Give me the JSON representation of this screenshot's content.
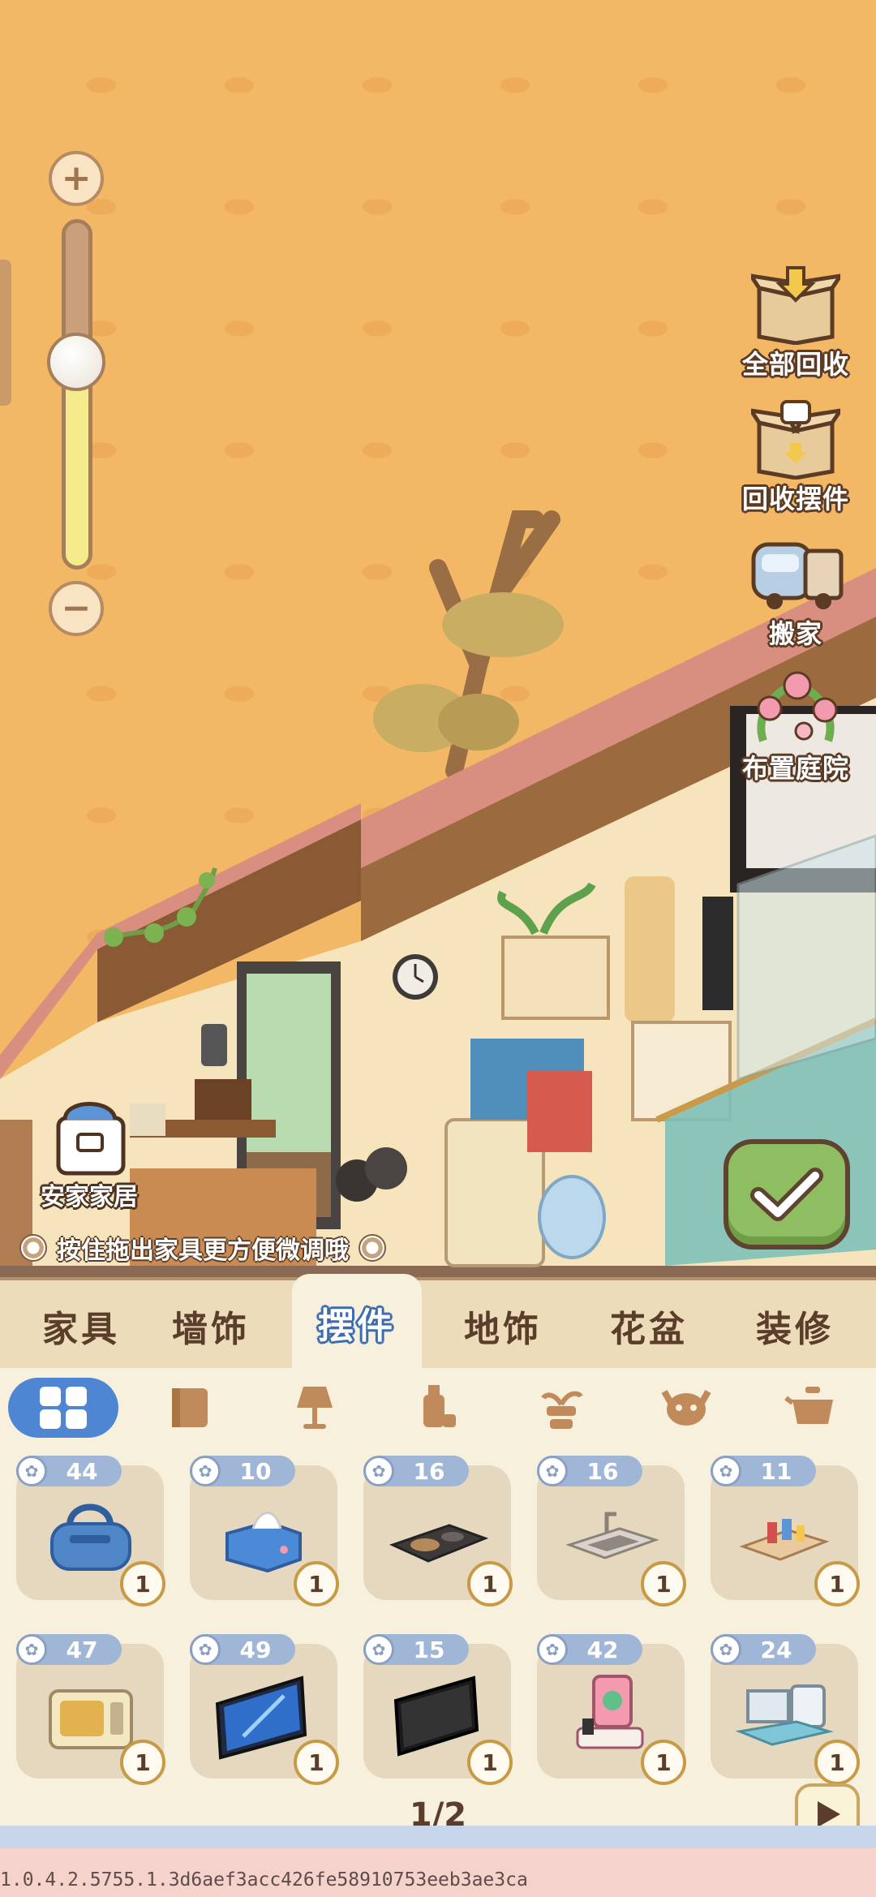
{
  "actions": [
    {
      "label": "全部回收",
      "icon": "box-collect-all-icon"
    },
    {
      "label": "回收摆件",
      "icon": "box-collect-ornament-icon"
    },
    {
      "label": "搬家",
      "icon": "moving-truck-icon"
    },
    {
      "label": "布置庭院",
      "icon": "garden-flowers-icon"
    }
  ],
  "anjia_label": "安家家居",
  "hint_text": "按住拖出家具更方便微调哦",
  "tabs": [
    {
      "label": "家具"
    },
    {
      "label": "墙饰"
    },
    {
      "label": "摆件",
      "active": true
    },
    {
      "label": "地饰"
    },
    {
      "label": "花盆"
    },
    {
      "label": "装修"
    }
  ],
  "subcategories": [
    "all-grid-icon",
    "rug-icon",
    "lamp-icon",
    "bottle-icon",
    "plant-stand-icon",
    "cow-head-icon",
    "teapot-icon"
  ],
  "items": [
    {
      "score": "44",
      "count": "1",
      "icon": "duffel-bag-icon"
    },
    {
      "score": "10",
      "count": "1",
      "icon": "tissue-box-icon"
    },
    {
      "score": "16",
      "count": "1",
      "icon": "induction-cooker-icon"
    },
    {
      "score": "16",
      "count": "1",
      "icon": "kitchen-sink-icon"
    },
    {
      "score": "11",
      "count": "1",
      "icon": "cosmetics-tray-icon"
    },
    {
      "score": "47",
      "count": "1",
      "icon": "microwave-icon"
    },
    {
      "score": "49",
      "count": "1",
      "icon": "tv-blue-icon"
    },
    {
      "score": "15",
      "count": "1",
      "icon": "tv-black-icon"
    },
    {
      "score": "42",
      "count": "1",
      "icon": "game-console-icon"
    },
    {
      "score": "24",
      "count": "1",
      "icon": "computer-desk-icon"
    }
  ],
  "pager": "1/2",
  "version": "1.0.4.2.5755.1.3d6aef3acc426fe58910753eeb3ae3ca",
  "colors": {
    "accent_blue": "#4f86d4",
    "confirm_green": "#8fbe62",
    "wall": "#f3b865"
  }
}
